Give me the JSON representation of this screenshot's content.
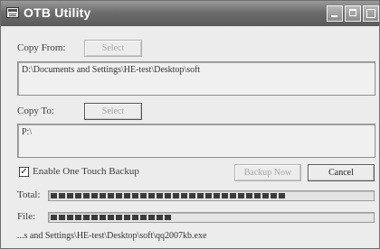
{
  "window": {
    "title": "OTB Utility"
  },
  "copy_from": {
    "label": "Copy From:",
    "select_label": "Select",
    "path": "D:\\Documents and Settings\\HE-test\\Desktop\\soft"
  },
  "copy_to": {
    "label": "Copy To:",
    "select_label": "Select",
    "path": "P:\\"
  },
  "options": {
    "one_touch_label": "Enable One Touch Backup",
    "one_touch_checked": true,
    "check_mark": "✓"
  },
  "actions": {
    "backup_label": "Backup Now",
    "cancel_label": "Cancel"
  },
  "progress": {
    "total_label": "Total:",
    "total_fraction": 0.73,
    "file_label": "File:",
    "file_fraction": 0.38
  },
  "status": {
    "current_file": "...s and Settings\\HE-test\\Desktop\\soft\\qq2007kb.exe"
  }
}
